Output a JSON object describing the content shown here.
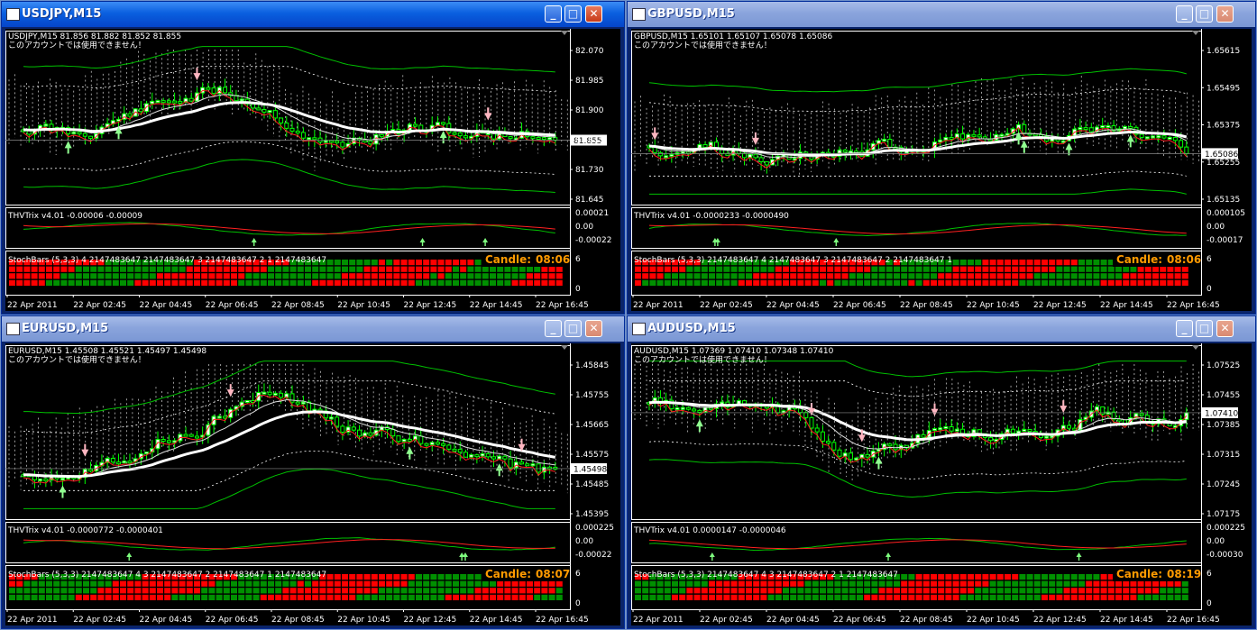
{
  "colors": {
    "bg": "#000000",
    "bull": "#00ff00",
    "bear": "#ff0000",
    "cloud": "#ffffff",
    "ma": "#ffffff",
    "accent": "#ff9a00",
    "grid": "#ffffff",
    "up_arrow": "#7fff7f",
    "down_arrow": "#ffb6c1"
  },
  "common": {
    "notice": "このアカウントでは使用できません！",
    "candle_label": "Candle:",
    "time_labels": [
      "22 Apr 2011",
      "22 Apr 02:45",
      "22 Apr 04:45",
      "22 Apr 06:45",
      "22 Apr 08:45",
      "22 Apr 10:45",
      "22 Apr 12:45",
      "22 Apr 14:45",
      "22 Apr 16:45"
    ],
    "stoch_axis": [
      "6",
      "0"
    ]
  },
  "windows": [
    {
      "title": "USDJPY,M15",
      "active": true,
      "header": "USDJPY,M15  81.856 81.882 81.852 81.855",
      "price_axis": [
        "82.070",
        "81.985",
        "81.900",
        "81.815",
        "81.730",
        "81.645"
      ],
      "current_price": "81.855",
      "thv_label": "THVTrix v4.01 -0.00006 -0.00009",
      "thv_axis": [
        "0.00021",
        "0.00",
        "-0.00022"
      ],
      "stoch_label": "StochBars (5,3,3) 4 2147483647 2147483647 3 2147483647 2 1 2147483647",
      "candle_time": "08:06"
    },
    {
      "title": "GBPUSD,M15",
      "active": false,
      "header": "GBPUSD,M15  1.65101 1.65107 1.65078 1.65086",
      "price_axis": [
        "1.65615",
        "1.65495",
        "1.65375",
        "1.65255",
        "1.65135"
      ],
      "current_price": "1.65086",
      "thv_label": "THVTrix v4.01 -0.0000233 -0.0000490",
      "thv_axis": [
        "0.000105",
        "0.00",
        "-0.00017"
      ],
      "stoch_label": "StochBars (5,3,3) 2147483647 4 2147483647 3 2147483647 2 2147483647 1",
      "candle_time": "08:06"
    },
    {
      "title": "EURUSD,M15",
      "active": false,
      "header": "EURUSD,M15  1.45508 1.45521 1.45497 1.45498",
      "price_axis": [
        "1.45845",
        "1.45755",
        "1.45665",
        "1.45575",
        "1.45485",
        "1.45395"
      ],
      "current_price": "1.45498",
      "thv_label": "THVTrix v4.01 -0.0000772 -0.0000401",
      "thv_axis": [
        "0.000225",
        "0.00",
        "-0.00022"
      ],
      "stoch_label": "StochBars (5,3,3) 2147483647 4 3 2147483647 2 2147483647 1 2147483647",
      "candle_time": "08:07"
    },
    {
      "title": "AUDUSD,M15",
      "active": false,
      "header": "AUDUSD,M15  1.07369 1.07410 1.07348 1.07410",
      "price_axis": [
        "1.07525",
        "1.07455",
        "1.07385",
        "1.07315",
        "1.07245",
        "1.07175"
      ],
      "current_price": "1.07410",
      "thv_label": "THVTrix v4.01 0.0000147 -0.0000046",
      "thv_axis": [
        "0.000225",
        "0.00",
        "-0.00030"
      ],
      "stoch_label": "StochBars (5,3,3) 2147483647 4 3 2147483647 2 1 2147483647",
      "candle_time": "08:19"
    }
  ]
}
